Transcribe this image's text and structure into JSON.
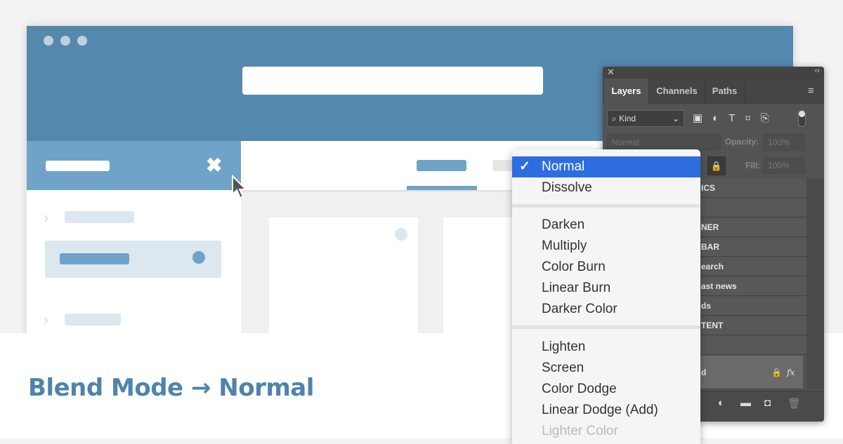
{
  "colors": {
    "header": "#5588ad",
    "sidebar_header": "#6fa3c7",
    "title": "#4f84aa",
    "selected": "#2d6de0",
    "panel": "#535353"
  },
  "headline": "Blend Mode → Normal",
  "layers_panel": {
    "tabs": [
      {
        "label": "Layers",
        "active": true
      },
      {
        "label": "Channels"
      },
      {
        "label": "Paths"
      }
    ],
    "filter": "Kind",
    "blend_value": "Normal",
    "opacity_label": "Opacity:",
    "opacity_value": "100%",
    "fill_label": "Fill:",
    "fill_value": "100%",
    "layers": [
      "ICS",
      "",
      "NER",
      "BAR",
      "earch",
      "ast news",
      "ds",
      "TENT",
      "",
      "d"
    ]
  },
  "blend_menu": {
    "groups": [
      [
        "Normal",
        "Dissolve"
      ],
      [
        "Darken",
        "Multiply",
        "Color Burn",
        "Linear Burn",
        "Darker Color"
      ],
      [
        "Lighten",
        "Screen",
        "Color Dodge",
        "Linear Dodge (Add)",
        "Lighter Color"
      ]
    ],
    "selected": "Normal",
    "check": "✓"
  }
}
